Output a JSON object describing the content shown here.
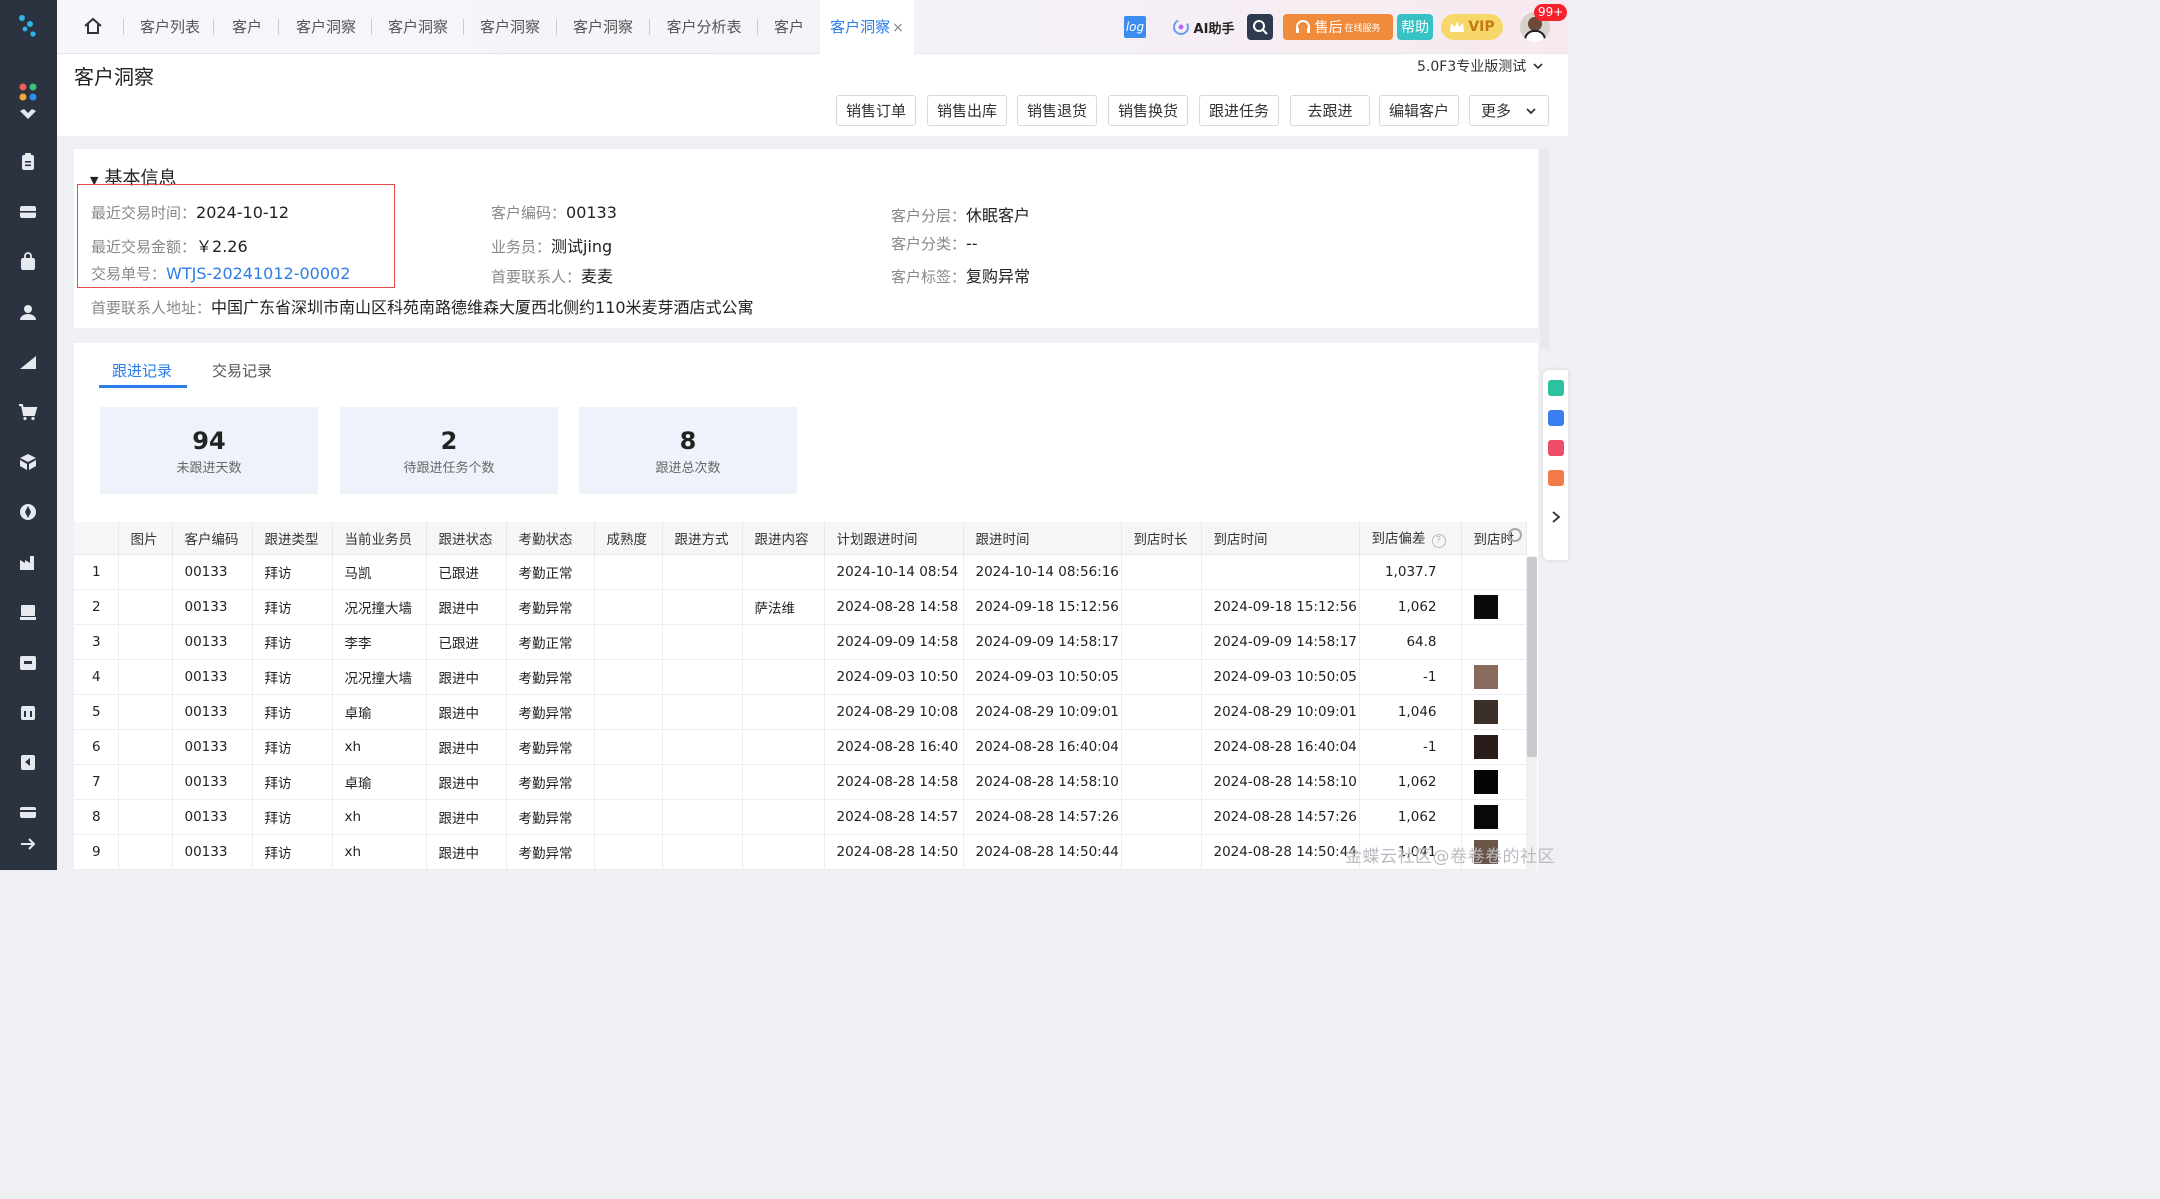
{
  "topbar": {
    "tabs": [
      "客户列表",
      "客户",
      "客户洞察",
      "客户洞察",
      "客户洞察",
      "客户洞察",
      "客户分析表",
      "客户",
      "客户洞察"
    ],
    "close_glyph": "×",
    "log_label": "log",
    "ai_label": "AI助手",
    "service_label": "售后",
    "service_sub": "在线服务",
    "help_label": "帮助",
    "vip_label": "VIP",
    "badge": "99+"
  },
  "page": {
    "title": "客户洞察",
    "version": "5.0F3专业版测试",
    "actions": [
      "销售订单",
      "销售出库",
      "销售退货",
      "销售换货",
      "跟进任务",
      "去跟进",
      "编辑客户"
    ],
    "more_label": "更多"
  },
  "basic": {
    "section_title": "基本信息",
    "last_trade_time_label": "最近交易时间：",
    "last_trade_time": "2024-10-12",
    "last_trade_amount_label": "最近交易金额：",
    "last_trade_amount": "￥2.26",
    "trade_no_label": "交易单号：",
    "trade_no": "WTJS-20241012-00002",
    "address_label": "首要联系人地址：",
    "address": "中国广东省深圳市南山区科苑南路德维森大厦西北侧约110米麦芽酒店式公寓",
    "code_label": "客户编码：",
    "code": "00133",
    "salesman_label": "业务员：",
    "salesman": "测试jing",
    "contact_label": "首要联系人：",
    "contact": "麦麦",
    "tier_label": "客户分层：",
    "tier": "休眠客户",
    "category_label": "客户分类：",
    "category": "--",
    "tag_label": "客户标签：",
    "tag": "复购异常"
  },
  "records": {
    "tabs": [
      "跟进记录",
      "交易记录"
    ],
    "stats": [
      {
        "value": "94",
        "label": "未跟进天数"
      },
      {
        "value": "2",
        "label": "待跟进任务个数"
      },
      {
        "value": "8",
        "label": "跟进总次数"
      }
    ],
    "columns": [
      "",
      "图片",
      "客户编码",
      "跟进类型",
      "当前业务员",
      "跟进状态",
      "考勤状态",
      "成熟度",
      "跟进方式",
      "跟进内容",
      "计划跟进时间",
      "跟进时间",
      "到店时长",
      "到店时间",
      "到店偏差",
      "到店时"
    ],
    "rows": [
      [
        "1",
        "",
        "00133",
        "拜访",
        "马凯",
        "已跟进",
        "考勤正常",
        "",
        "",
        "",
        "2024-10-14 08:54",
        "2024-10-14 08:56:16",
        "",
        "",
        "1,037.7",
        ""
      ],
      [
        "2",
        "",
        "00133",
        "拜访",
        "况况撞大墙",
        "跟进中",
        "考勤异常",
        "",
        "",
        "萨法维",
        "2024-08-28 14:58",
        "2024-09-18 15:12:56",
        "",
        "2024-09-18 15:12:56",
        "1,062",
        "#0a0a0a"
      ],
      [
        "3",
        "",
        "00133",
        "拜访",
        "李李",
        "已跟进",
        "考勤正常",
        "",
        "",
        "",
        "2024-09-09 14:58",
        "2024-09-09 14:58:17",
        "",
        "2024-09-09 14:58:17",
        "64.8",
        ""
      ],
      [
        "4",
        "",
        "00133",
        "拜访",
        "况况撞大墙",
        "跟进中",
        "考勤异常",
        "",
        "",
        "",
        "2024-09-03 10:50",
        "2024-09-03 10:50:05",
        "",
        "2024-09-03 10:50:05",
        "-1",
        "#8a6a5c"
      ],
      [
        "5",
        "",
        "00133",
        "拜访",
        "卓瑜",
        "跟进中",
        "考勤异常",
        "",
        "",
        "",
        "2024-08-29 10:08",
        "2024-08-29 10:09:01",
        "",
        "2024-08-29 10:09:01",
        "1,046",
        "#3a2e28"
      ],
      [
        "6",
        "",
        "00133",
        "拜访",
        "xh",
        "跟进中",
        "考勤异常",
        "",
        "",
        "",
        "2024-08-28 16:40",
        "2024-08-28 16:40:04",
        "",
        "2024-08-28 16:40:04",
        "-1",
        "#2a1c18"
      ],
      [
        "7",
        "",
        "00133",
        "拜访",
        "卓瑜",
        "跟进中",
        "考勤异常",
        "",
        "",
        "",
        "2024-08-28 14:58",
        "2024-08-28 14:58:10",
        "",
        "2024-08-28 14:58:10",
        "1,062",
        "#050505"
      ],
      [
        "8",
        "",
        "00133",
        "拜访",
        "xh",
        "跟进中",
        "考勤异常",
        "",
        "",
        "",
        "2024-08-28 14:57",
        "2024-08-28 14:57:26",
        "",
        "2024-08-28 14:57:26",
        "1,062",
        "#080808"
      ],
      [
        "9",
        "",
        "00133",
        "拜访",
        "xh",
        "跟进中",
        "考勤异常",
        "",
        "",
        "",
        "2024-08-28 14:50",
        "2024-08-28 14:50:44",
        "",
        "2024-08-28 14:50:44",
        "1,041",
        "#6b5448"
      ]
    ]
  },
  "watermark": "金蝶云社区@卷卷卷的社区"
}
